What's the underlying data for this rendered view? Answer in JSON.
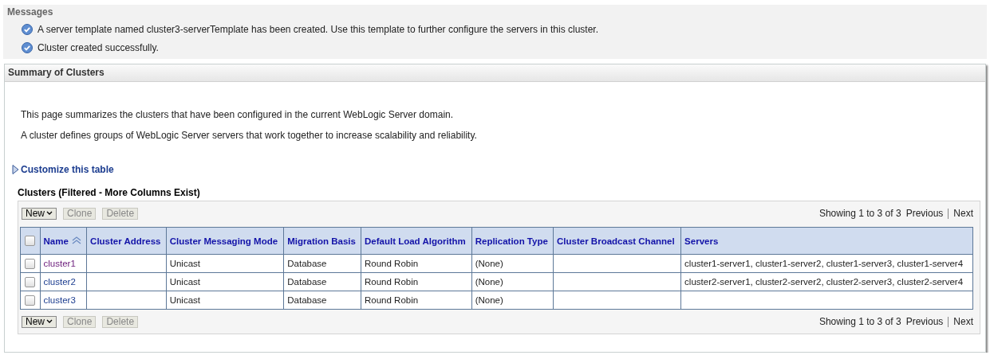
{
  "messages": {
    "title": "Messages",
    "items": [
      "A server template named cluster3-serverTemplate has been created. Use this template to further configure the servers in this cluster.",
      "Cluster created successfully."
    ]
  },
  "panel": {
    "title": "Summary of Clusters",
    "paragraphs": [
      "This page summarizes the clusters that have been configured in the current WebLogic Server domain.",
      "A cluster defines groups of WebLogic Server servers that work together to increase scalability and reliability."
    ],
    "customize": {
      "label": "Customize this table",
      "expanded": false
    },
    "table_title": "Clusters (Filtered - More Columns Exist)",
    "toolbars": [
      {
        "buttons": [
          {
            "label": "New",
            "kind": "menu",
            "disabled": false
          },
          {
            "label": "Clone",
            "kind": "plain",
            "disabled": true
          },
          {
            "label": "Delete",
            "kind": "plain",
            "disabled": true
          }
        ],
        "paging": {
          "showing": "Showing 1 to 3 of 3",
          "previous": "Previous",
          "next": "Next"
        }
      },
      {
        "buttons": [
          {
            "label": "New",
            "kind": "menu",
            "disabled": false
          },
          {
            "label": "Clone",
            "kind": "plain",
            "disabled": true
          },
          {
            "label": "Delete",
            "kind": "plain",
            "disabled": true
          }
        ],
        "paging": {
          "showing": "Showing 1 to 3 of 3",
          "previous": "Previous",
          "next": "Next"
        }
      }
    ],
    "table": {
      "select_all": {
        "checked": false
      },
      "columns": [
        {
          "label": "Name",
          "sorted": true
        },
        {
          "label": "Cluster Address",
          "sorted": false
        },
        {
          "label": "Cluster Messaging Mode",
          "sorted": false
        },
        {
          "label": "Migration Basis",
          "sorted": false
        },
        {
          "label": "Default Load Algorithm",
          "sorted": false
        },
        {
          "label": "Replication Type",
          "sorted": false
        },
        {
          "label": "Cluster Broadcast Channel",
          "sorted": false
        },
        {
          "label": "Servers",
          "sorted": false
        }
      ],
      "rows": [
        {
          "checked": false,
          "visited": true,
          "cells": [
            "cluster1",
            "",
            "Unicast",
            "Database",
            "Round Robin",
            "(None)",
            "",
            "cluster1-server1, cluster1-server2, cluster1-server3, cluster1-server4"
          ]
        },
        {
          "checked": false,
          "visited": false,
          "cells": [
            "cluster2",
            "",
            "Unicast",
            "Database",
            "Round Robin",
            "(None)",
            "",
            "cluster2-server1, cluster2-server2, cluster2-server3, cluster2-server4"
          ]
        },
        {
          "checked": false,
          "visited": false,
          "cells": [
            "cluster3",
            "",
            "Unicast",
            "Database",
            "Round Robin",
            "(None)",
            "",
            ""
          ]
        }
      ]
    }
  }
}
